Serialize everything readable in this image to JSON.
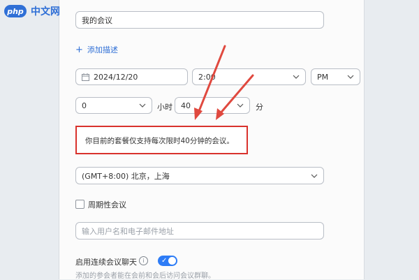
{
  "watermark": {
    "badge": "php",
    "text": "中文网"
  },
  "meeting": {
    "title": "我的会议",
    "add_description": "添加描述",
    "date": "2024/12/20",
    "time": "2:00",
    "ampm": "PM",
    "duration_hours": "0",
    "hours_unit": "小时",
    "duration_minutes": "40",
    "minutes_unit": "分",
    "notice": "你目前的套餐仅支持每次限时40分钟的会议。",
    "timezone": "(GMT+8:00) 北京，上海",
    "recurring_label": "周期性会议",
    "invitee_placeholder": "输入用户名和电子邮件地址",
    "continuous_chat_label": "启用连续会议聊天",
    "continuous_chat_enabled": true,
    "continuous_chat_hint": "添加的参会者能在会前和会后访问会议群聊。"
  },
  "colors": {
    "accent": "#2f6fd6",
    "highlight_border": "#d9322c",
    "annotation_arrow": "#e0493f",
    "toggle_on": "#2d7cf6"
  },
  "icons": [
    "calendar-icon",
    "chevron-down-icon",
    "plus-icon",
    "info-icon",
    "check-icon"
  ]
}
